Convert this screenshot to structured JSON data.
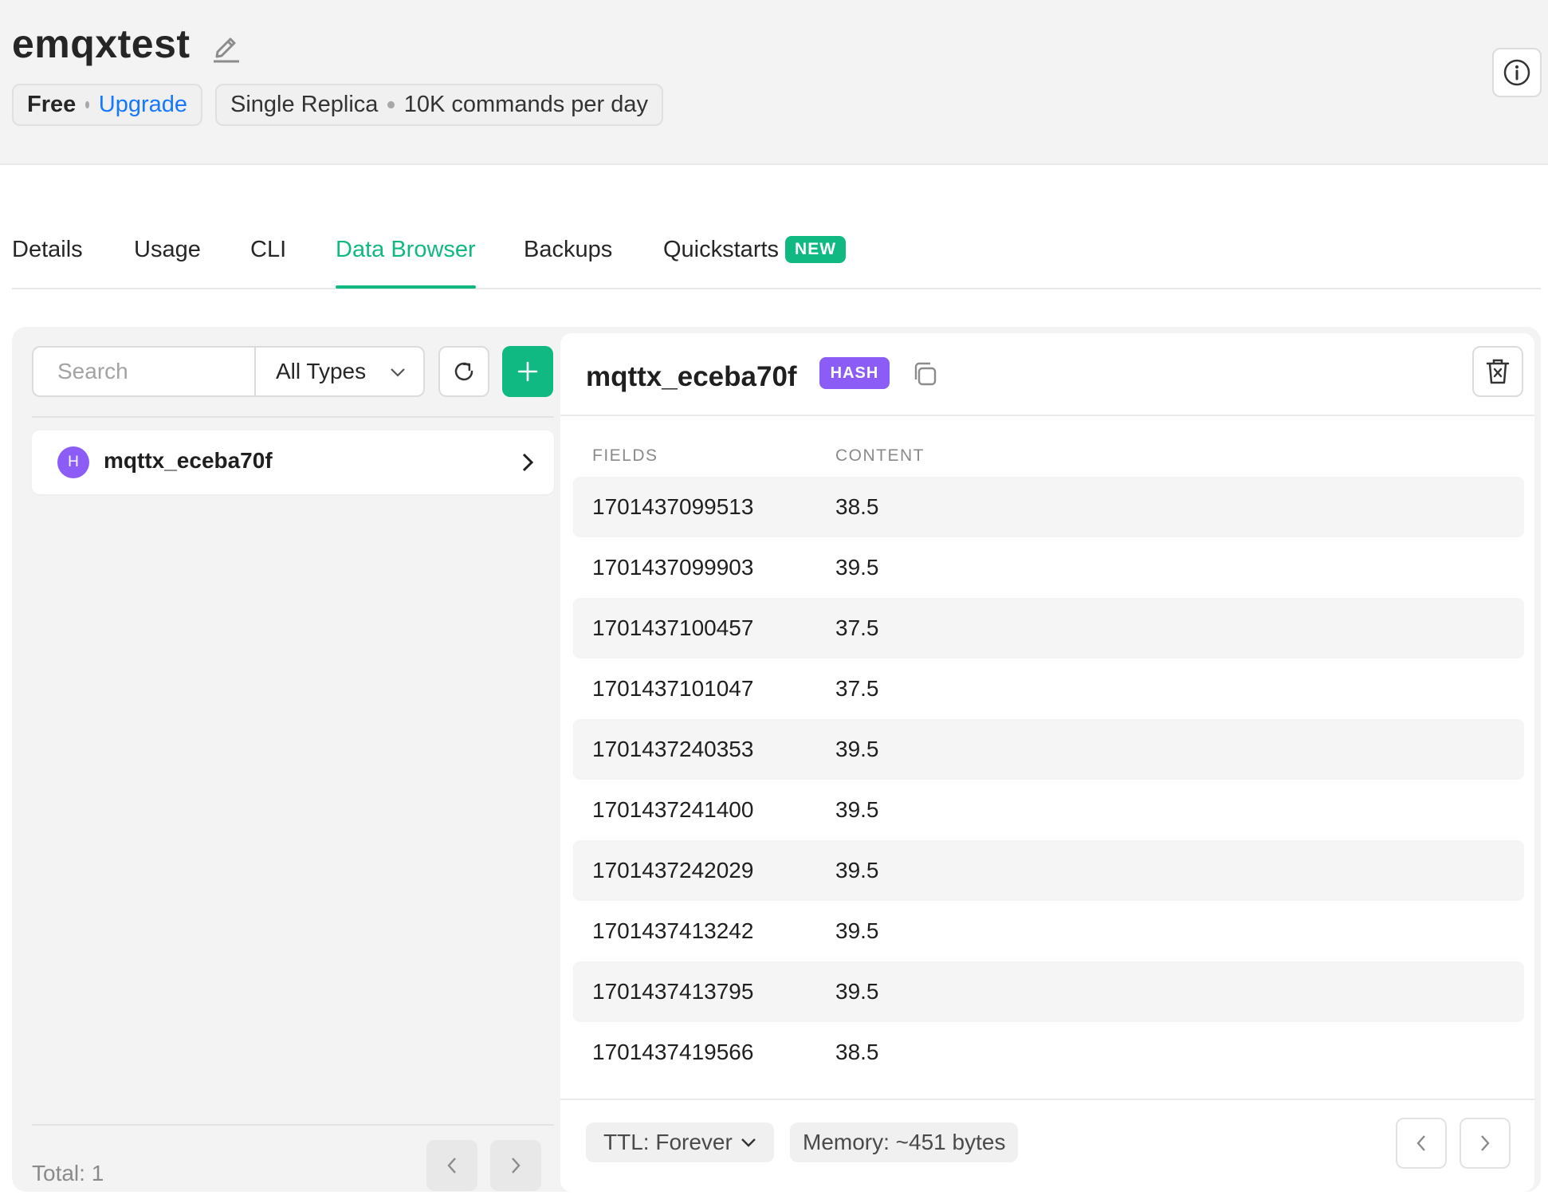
{
  "header": {
    "database_name": "emqxtest",
    "plan": "Free",
    "upgrade_label": "Upgrade",
    "replica": "Single Replica",
    "limit": "10K commands per day"
  },
  "tabs": [
    {
      "label": "Details"
    },
    {
      "label": "Usage"
    },
    {
      "label": "CLI"
    },
    {
      "label": "Data Browser",
      "active": true
    },
    {
      "label": "Backups"
    },
    {
      "label": "Quickstarts",
      "badge": "NEW"
    }
  ],
  "browser": {
    "search_placeholder": "Search",
    "type_filter": "All Types",
    "keys": [
      {
        "type_letter": "H",
        "name": "mqttx_eceba70f"
      }
    ],
    "total_label": "Total: 1"
  },
  "detail": {
    "key_name": "mqttx_eceba70f",
    "type_badge": "HASH",
    "col_fields": "FIELDS",
    "col_content": "CONTENT",
    "rows": [
      {
        "field": "1701437099513",
        "content": "38.5"
      },
      {
        "field": "1701437099903",
        "content": "39.5"
      },
      {
        "field": "1701437100457",
        "content": "37.5"
      },
      {
        "field": "1701437101047",
        "content": "37.5"
      },
      {
        "field": "1701437240353",
        "content": "39.5"
      },
      {
        "field": "1701437241400",
        "content": "39.5"
      },
      {
        "field": "1701437242029",
        "content": "39.5"
      },
      {
        "field": "1701437413242",
        "content": "39.5"
      },
      {
        "field": "1701437413795",
        "content": "39.5"
      },
      {
        "field": "1701437419566",
        "content": "38.5"
      }
    ],
    "ttl_label": "TTL: Forever",
    "memory_label": "Memory: ~451 bytes"
  },
  "colors": {
    "accent": "#10b981",
    "hash_type": "#8b5cf6",
    "link": "#1677ff"
  },
  "icons": [
    "pencil-icon",
    "info-icon",
    "chevron-down-icon",
    "refresh-icon",
    "plus-icon",
    "chevron-right-icon",
    "copy-icon",
    "trash-icon",
    "chevron-left-icon"
  ]
}
